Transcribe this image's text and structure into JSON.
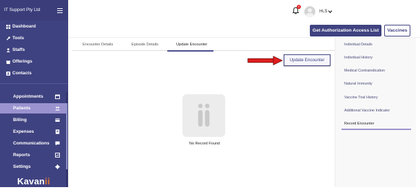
{
  "sidebar": {
    "company": "IT Support Pty Ltd",
    "top_items": [
      {
        "label": "Dashboard",
        "icon": "grid-icon"
      },
      {
        "label": "Tools",
        "icon": "wrench-icon"
      },
      {
        "label": "Staffs",
        "icon": "user-icon"
      },
      {
        "label": "Offerings",
        "icon": "gift-icon"
      },
      {
        "label": "Contacts",
        "icon": "contact-icon"
      }
    ],
    "bottom_items": [
      {
        "label": "Appointments",
        "icon": "calendar-icon"
      },
      {
        "label": "Patients",
        "icon": "people-icon",
        "active": true
      },
      {
        "label": "Billing",
        "icon": "card-icon"
      },
      {
        "label": "Expenses",
        "icon": "receipt-icon"
      },
      {
        "label": "Communications",
        "icon": "chat-icon"
      },
      {
        "label": "Reports",
        "icon": "report-icon"
      },
      {
        "label": "Settings",
        "icon": "gear-icon"
      }
    ],
    "logo_main": "Kavan",
    "logo_tail": "ii"
  },
  "header": {
    "notification_count": "0",
    "user_name": "Hi,S"
  },
  "actions": {
    "auth_label": "Get Authorization Access List",
    "vaccines_label": "Vaccines"
  },
  "tabs": [
    {
      "label": "Encounter Details"
    },
    {
      "label": "Episode Details"
    },
    {
      "label": "Update Encounter",
      "active": true
    }
  ],
  "main": {
    "update_button": "Update Encounter",
    "empty_text": "No Record Found"
  },
  "right_menu": [
    {
      "label": "Individual Details"
    },
    {
      "label": "Individual History"
    },
    {
      "label": "Medical Contraindication"
    },
    {
      "label": "Natural Immunity"
    },
    {
      "label": "Vaccine Trial History"
    },
    {
      "label": "Additional Vaccine Indicator"
    },
    {
      "label": "Record Encounter",
      "active": true
    }
  ],
  "colors": {
    "sidebar": "#3f4280",
    "active_item": "#9a93cf",
    "accent": "#3f4280",
    "arrow": "#e01e1e",
    "logo_dot": "#e57b2f"
  }
}
